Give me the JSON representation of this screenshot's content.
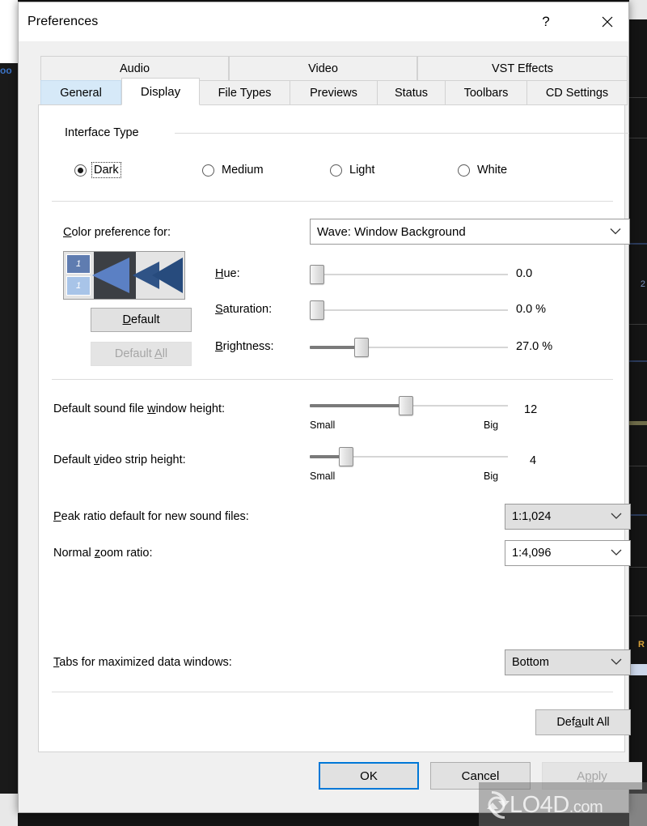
{
  "window": {
    "title": "Preferences",
    "help_icon": "question-mark-icon",
    "close_icon": "close-icon"
  },
  "tabs_row1": [
    {
      "label": "Audio",
      "active": false
    },
    {
      "label": "Video",
      "active": false
    },
    {
      "label": "VST Effects",
      "active": false
    }
  ],
  "tabs_row2": [
    {
      "label": "General",
      "state": "hover"
    },
    {
      "label": "Display",
      "state": "active"
    },
    {
      "label": "File Types",
      "state": "normal"
    },
    {
      "label": "Previews",
      "state": "normal"
    },
    {
      "label": "Status",
      "state": "normal"
    },
    {
      "label": "Toolbars",
      "state": "normal"
    },
    {
      "label": "CD Settings",
      "state": "normal"
    }
  ],
  "interface_type": {
    "group_label": "Interface Type",
    "options": [
      {
        "label": "Dark",
        "selected": true,
        "focused": true
      },
      {
        "label": "Medium",
        "selected": false,
        "focused": false
      },
      {
        "label": "Light",
        "selected": false,
        "focused": false
      },
      {
        "label": "White",
        "selected": false,
        "focused": false
      }
    ]
  },
  "color_pref": {
    "label": "Color preference for:",
    "selected": "Wave: Window Background",
    "default_button": "Default",
    "default_all_button": "Default All",
    "default_all_disabled": true,
    "swatch_colors": {
      "cell_top": "#5f7cb0",
      "cell_bottom": "#a8c4e8",
      "dark_panel": "#3c3f44",
      "light_panel": "#e4e4e4",
      "arrow_light": "#5b80c4",
      "arrow_mid": "#2f5386",
      "arrow_dark": "#274b7d",
      "swatch_number": "1"
    },
    "sliders": [
      {
        "label": "Hue:",
        "value_text": "0.0",
        "percent": 0
      },
      {
        "label": "Saturation:",
        "value_text": "0.0 %",
        "percent": 0
      },
      {
        "label": "Brightness:",
        "value_text": "27.0 %",
        "percent": 27
      }
    ]
  },
  "heights": [
    {
      "label": "Default sound file window height:",
      "value_text": "12",
      "percent": 47,
      "min_label": "Small",
      "max_label": "Big"
    },
    {
      "label": "Default video strip height:",
      "value_text": "4",
      "percent": 15,
      "min_label": "Small",
      "max_label": "Big"
    }
  ],
  "combos": [
    {
      "label": "Peak ratio default for new sound files:",
      "value": "1:1,024",
      "hover": true
    },
    {
      "label": "Normal zoom ratio:",
      "value": "1:4,096",
      "hover": false
    },
    {
      "label": "Tabs for maximized data windows:",
      "value": "Bottom",
      "hover": true
    }
  ],
  "page_default_all": "Default All",
  "footer": {
    "ok": "OK",
    "cancel": "Cancel",
    "apply": "Apply",
    "apply_disabled": true,
    "ok_accent": "#0078d7"
  },
  "watermark": {
    "text": "LO4D",
    "suffix": ".com"
  },
  "background": {
    "right_label": "R",
    "right_number": "2"
  }
}
